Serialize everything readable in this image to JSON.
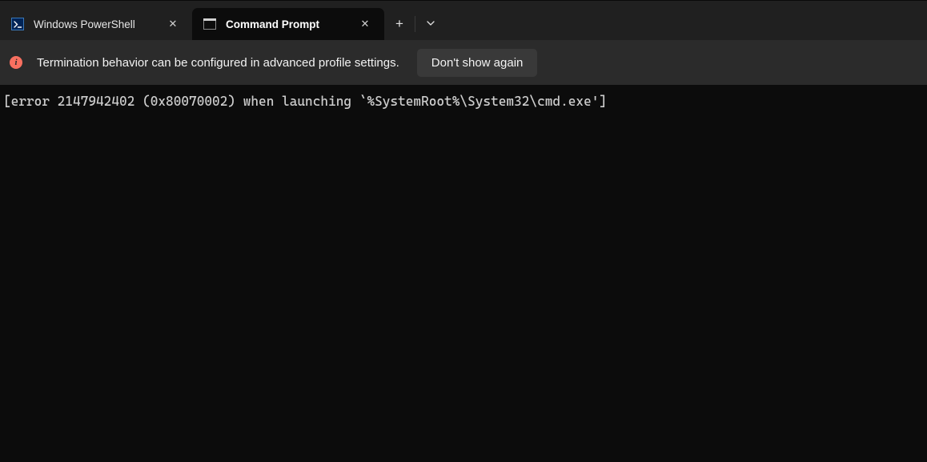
{
  "tabs": [
    {
      "label": "Windows PowerShell",
      "active": false,
      "icon": "powershell-icon"
    },
    {
      "label": "Command Prompt",
      "active": true,
      "icon": "cmd-icon"
    }
  ],
  "titlebar": {
    "new_tab_glyph": "+",
    "dropdown_glyph": "⌄",
    "close_glyph": "✕"
  },
  "info_bar": {
    "icon_glyph": "i",
    "message": "Termination behavior can be configured in advanced profile settings.",
    "button_label": "Don't show again"
  },
  "terminal": {
    "output": "[error 2147942402 (0x80070002) when launching `%SystemRoot%\\System32\\cmd.exe']"
  }
}
